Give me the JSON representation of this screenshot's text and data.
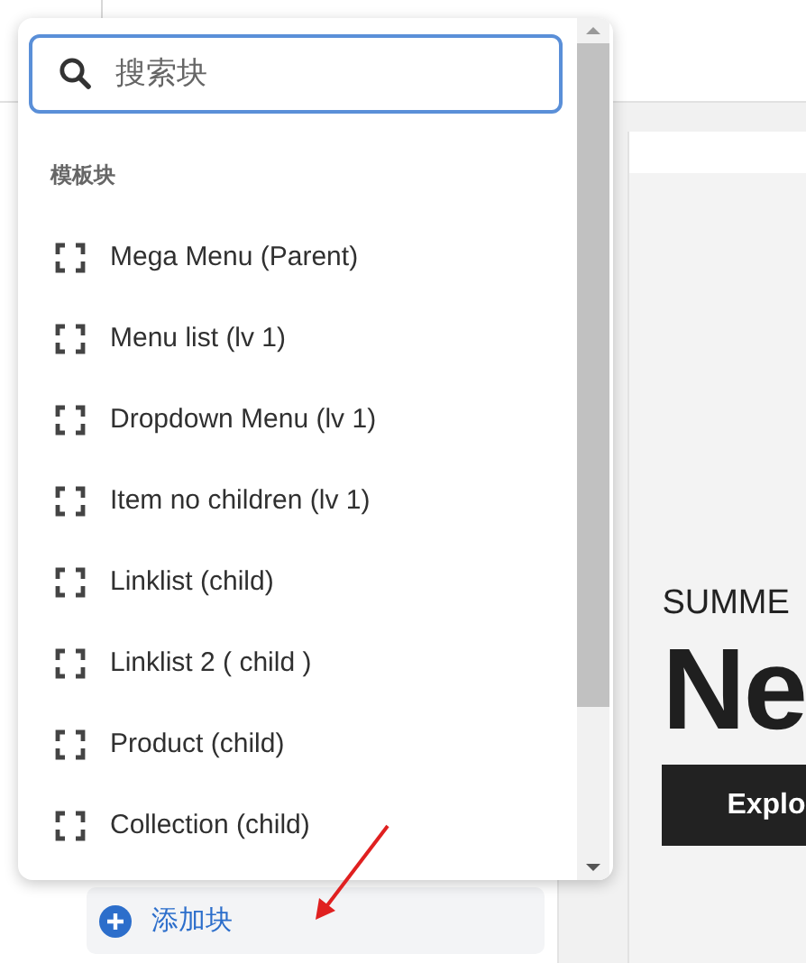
{
  "search": {
    "placeholder": "搜索块"
  },
  "section_heading": "模板块",
  "blocks": [
    {
      "label": "Mega Menu (Parent)"
    },
    {
      "label": "Menu list (lv 1)"
    },
    {
      "label": "Dropdown Menu (lv 1)"
    },
    {
      "label": "Item no children (lv 1)"
    },
    {
      "label": "Linklist (child)"
    },
    {
      "label": "Linklist 2 ( child )"
    },
    {
      "label": "Product (child)"
    },
    {
      "label": "Collection (child)"
    }
  ],
  "add_button": {
    "label": "添加块"
  },
  "preview": {
    "eyebrow": "SUMME",
    "heading": "Ne",
    "button": "Explo"
  }
}
